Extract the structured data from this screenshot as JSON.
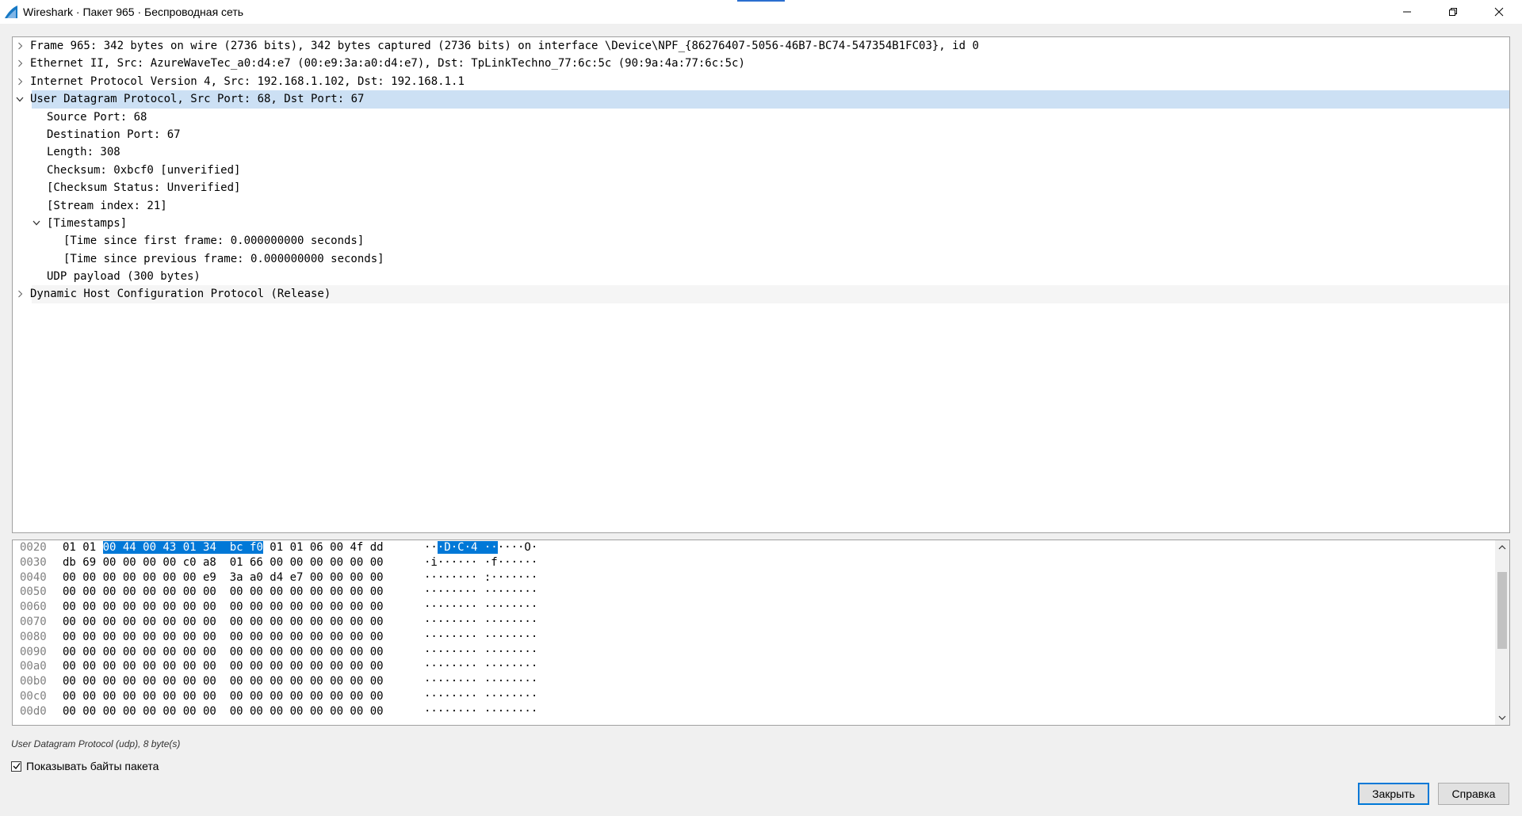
{
  "window": {
    "title": "Wireshark · Пакет 965 · Беспроводная сеть"
  },
  "tree": {
    "rows": [
      {
        "text": "Frame 965: 342 bytes on wire (2736 bits), 342 bytes captured (2736 bits) on interface \\Device\\NPF_{86276407-5056-46B7-BC74-547354B1FC03}, id 0",
        "expander": "collapsed",
        "level": 0
      },
      {
        "text": "Ethernet II, Src: AzureWaveTec_a0:d4:e7 (00:e9:3a:a0:d4:e7), Dst: TpLinkTechno_77:6c:5c (90:9a:4a:77:6c:5c)",
        "expander": "collapsed",
        "level": 0
      },
      {
        "text": "Internet Protocol Version 4, Src: 192.168.1.102, Dst: 192.168.1.1",
        "expander": "collapsed",
        "level": 0
      },
      {
        "text": "User Datagram Protocol, Src Port: 68, Dst Port: 67",
        "expander": "expanded",
        "level": 0,
        "selected": true
      },
      {
        "text": "Source Port: 68",
        "expander": "none",
        "level": 1
      },
      {
        "text": "Destination Port: 67",
        "expander": "none",
        "level": 1
      },
      {
        "text": "Length: 308",
        "expander": "none",
        "level": 1
      },
      {
        "text": "Checksum: 0xbcf0 [unverified]",
        "expander": "none",
        "level": 1
      },
      {
        "text": "[Checksum Status: Unverified]",
        "expander": "none",
        "level": 1
      },
      {
        "text": "[Stream index: 21]",
        "expander": "none",
        "level": 1
      },
      {
        "text": "[Timestamps]",
        "expander": "expanded",
        "level": 1
      },
      {
        "text": "[Time since first frame: 0.000000000 seconds]",
        "expander": "none",
        "level": 2
      },
      {
        "text": "[Time since previous frame: 0.000000000 seconds]",
        "expander": "none",
        "level": 2
      },
      {
        "text": "UDP payload (300 bytes)",
        "expander": "none",
        "level": 1
      },
      {
        "text": "Dynamic Host Configuration Protocol (Release)",
        "expander": "collapsed",
        "level": 0,
        "alt": true
      }
    ]
  },
  "hex": {
    "rows": [
      {
        "offset": "0020",
        "pre": "01 01 ",
        "hl": "00 44 00 43 01 34  bc f0",
        "post": " 01 01 06 00 4f dd",
        "ascii_pre": "··",
        "ascii_hl": "·D·C·4 ··",
        "ascii_post": "····O·"
      },
      {
        "offset": "0030",
        "pre": "db 69 00 00 00 00 c0 a8  01 66 00 00 00 00 00 00",
        "hl": "",
        "post": "",
        "ascii_pre": "·i······ ·f······",
        "ascii_hl": "",
        "ascii_post": ""
      },
      {
        "offset": "0040",
        "pre": "00 00 00 00 00 00 00 e9  3a a0 d4 e7 00 00 00 00",
        "hl": "",
        "post": "",
        "ascii_pre": "········ :·······",
        "ascii_hl": "",
        "ascii_post": ""
      },
      {
        "offset": "0050",
        "pre": "00 00 00 00 00 00 00 00  00 00 00 00 00 00 00 00",
        "hl": "",
        "post": "",
        "ascii_pre": "········ ········",
        "ascii_hl": "",
        "ascii_post": ""
      },
      {
        "offset": "0060",
        "pre": "00 00 00 00 00 00 00 00  00 00 00 00 00 00 00 00",
        "hl": "",
        "post": "",
        "ascii_pre": "········ ········",
        "ascii_hl": "",
        "ascii_post": ""
      },
      {
        "offset": "0070",
        "pre": "00 00 00 00 00 00 00 00  00 00 00 00 00 00 00 00",
        "hl": "",
        "post": "",
        "ascii_pre": "········ ········",
        "ascii_hl": "",
        "ascii_post": ""
      },
      {
        "offset": "0080",
        "pre": "00 00 00 00 00 00 00 00  00 00 00 00 00 00 00 00",
        "hl": "",
        "post": "",
        "ascii_pre": "········ ········",
        "ascii_hl": "",
        "ascii_post": ""
      },
      {
        "offset": "0090",
        "pre": "00 00 00 00 00 00 00 00  00 00 00 00 00 00 00 00",
        "hl": "",
        "post": "",
        "ascii_pre": "········ ········",
        "ascii_hl": "",
        "ascii_post": ""
      },
      {
        "offset": "00a0",
        "pre": "00 00 00 00 00 00 00 00  00 00 00 00 00 00 00 00",
        "hl": "",
        "post": "",
        "ascii_pre": "········ ········",
        "ascii_hl": "",
        "ascii_post": ""
      },
      {
        "offset": "00b0",
        "pre": "00 00 00 00 00 00 00 00  00 00 00 00 00 00 00 00",
        "hl": "",
        "post": "",
        "ascii_pre": "········ ········",
        "ascii_hl": "",
        "ascii_post": ""
      },
      {
        "offset": "00c0",
        "pre": "00 00 00 00 00 00 00 00  00 00 00 00 00 00 00 00",
        "hl": "",
        "post": "",
        "ascii_pre": "········ ········",
        "ascii_hl": "",
        "ascii_post": ""
      },
      {
        "offset": "00d0",
        "pre": "00 00 00 00 00 00 00 00  00 00 00 00 00 00 00 00",
        "hl": "",
        "post": "",
        "ascii_pre": "········ ········",
        "ascii_hl": "",
        "ascii_post": ""
      }
    ]
  },
  "status": {
    "text": "User Datagram Protocol (udp), 8 byte(s)"
  },
  "options": {
    "show_bytes_label": "Показывать байты пакета",
    "show_bytes_checked": true
  },
  "buttons": {
    "close": "Закрыть",
    "help": "Справка"
  },
  "colors": {
    "selection": "#cce0f4",
    "hex_highlight": "#0078d7",
    "accent": "#0078d7"
  }
}
